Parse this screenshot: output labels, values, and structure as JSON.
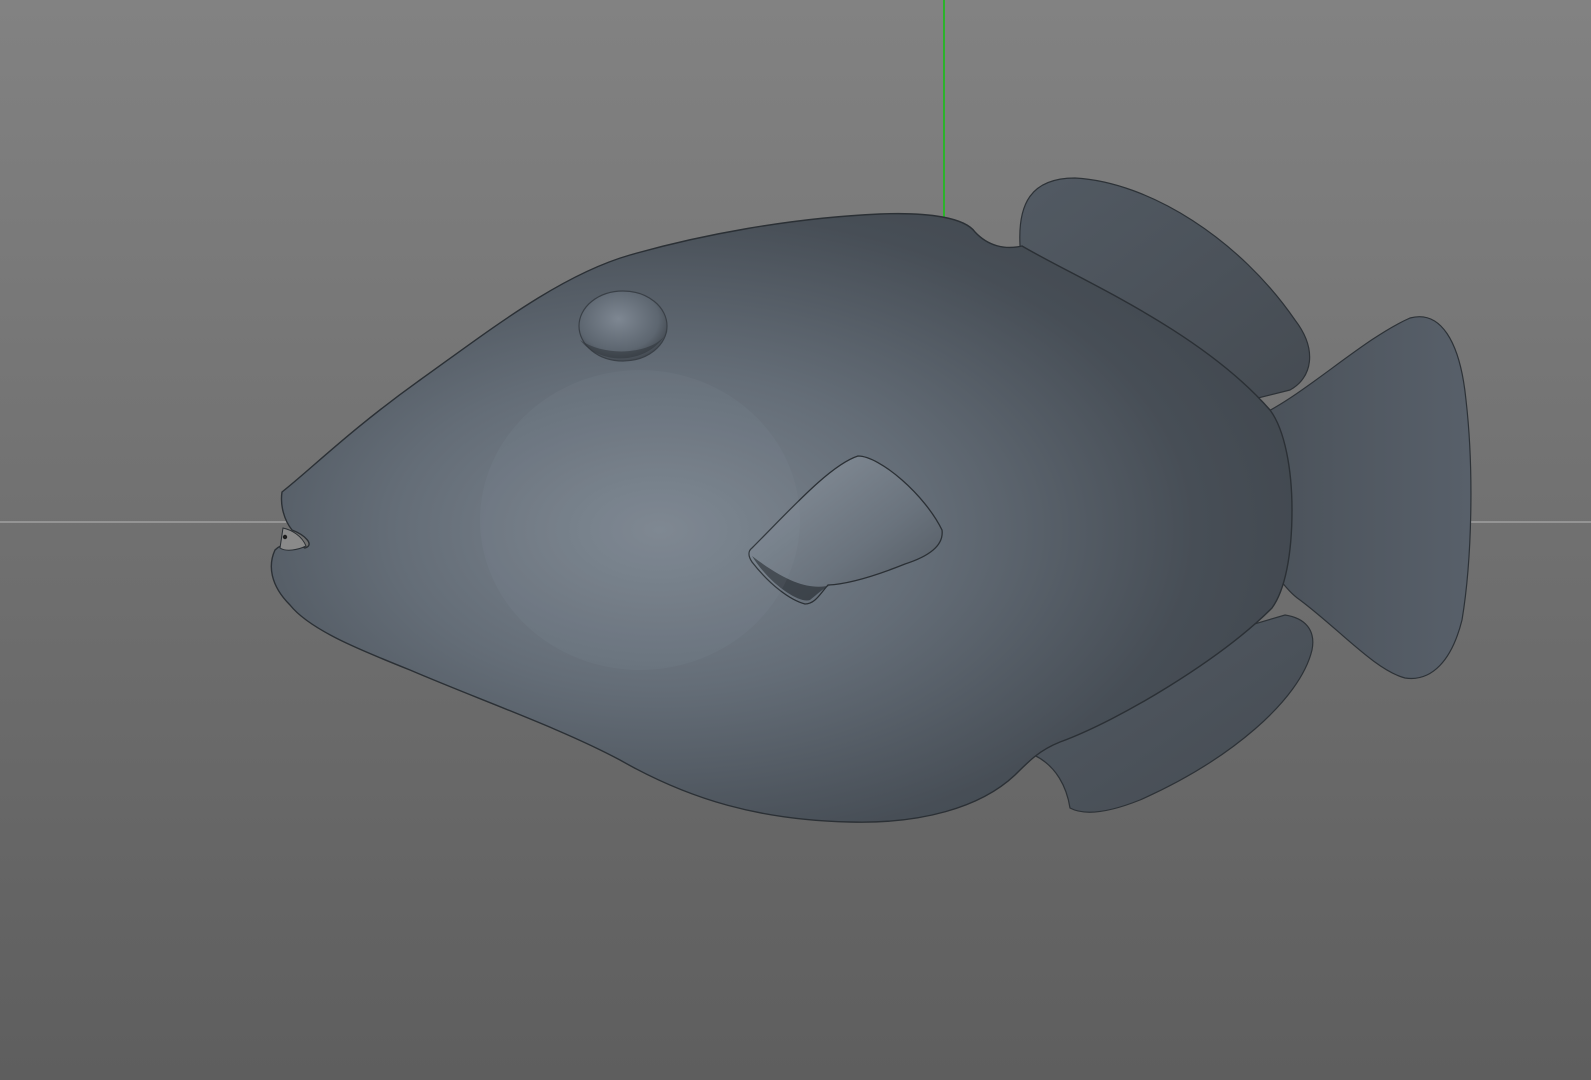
{
  "viewport": {
    "background_colors": [
      "#828282",
      "#5e5e5e"
    ],
    "view": "front-orthographic"
  },
  "axes": {
    "y_axis_color": "#2bb32b",
    "x_axis_color": "#b5b5b5"
  },
  "model": {
    "object": "fish",
    "shading": "gouraud-shaded",
    "base_color": "#5a636d"
  },
  "icons": {
    "left_panel": "panel-edge"
  }
}
